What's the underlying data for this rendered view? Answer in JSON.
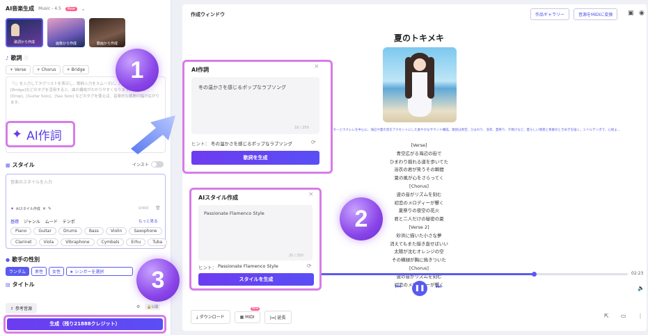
{
  "left": {
    "title": "AI音楽生成",
    "model": "Music - 4.5",
    "model_badge": "New",
    "presets": [
      "歌詞から作成",
      "画像から作成",
      "動画から作成"
    ],
    "lyrics_label": "歌詞",
    "tags": [
      "+ Verse",
      "+ Chorus",
      "+ Bridge"
    ],
    "lyrics_placeholder": "「/」を入力してタグリストを表示し、歌詞入力をスムーズに。[Verse]、[Chorus]、[Bridge]などのタグを活用すると、曲の構成がわかりやすくなります。さらに、[Drop]、[Guitar Solo]、[Sax Solo] などのタグを使えば、音楽的な展開の幅が広がります。",
    "ai_lyrics_big": "AI作詞",
    "style_label": "スタイル",
    "instrumental_label": "インスト",
    "style_placeholder": "音楽のスタイルを入力",
    "ai_style_small": "AIスタイル作成",
    "style_counter": "0/400",
    "style_tabs": [
      "基礎",
      "ジャンル",
      "ムード",
      "テンポ"
    ],
    "more": "もっと見る",
    "instruments_row1": [
      "Piano",
      "Guitar",
      "Drums",
      "Bass",
      "Violin",
      "Saxophone"
    ],
    "instruments_row2": [
      "Clarinet",
      "Viola",
      "Vibraphone",
      "Cymbals",
      "Erhu",
      "Tuba"
    ],
    "gender_label": "歌手の性別",
    "gender_options": [
      "ランダム",
      "男性",
      "女性"
    ],
    "singer_select": "シンガーを選択",
    "title_label": "タイトル",
    "ref_audio": "参考音源",
    "toggle_label": "公開",
    "generate": "生成（残り21888クレジット）"
  },
  "main": {
    "window_title": "作成ウィンドウ",
    "gallery_btn": "作品ギャラリー",
    "midi_convert_btn": "音源をMIDIに変換",
    "song_title": "夏のトキメキ",
    "style_desc": "ギターとウクレレを中心に、海辺や夏の音をアクセントにした爽やかなサウンド構成。歌詞は青空、ひまわり、浴衣、夏祭り、夕焼けなど、夏らしい情景と青春のときめきを描く。ミドルテンポで、心地よ…",
    "lyrics": [
      "[Verse]",
      "青空広がる海辺の街で",
      "ひまわり揺れる道を歩いてた",
      "浴衣の君が笑うその瞬間",
      "夏の風が心をさらってく",
      "[Chorus]",
      "波の音がリズムを刻む",
      "初恋のメロディーが響く",
      "夏祭りの夜空の花火",
      "君と二人だけの秘密の夏",
      "[Verse 2]",
      "砂浜に描いた小さな夢",
      "消えてもまた描き直せばいい",
      "太陽が沈むオレンジの空",
      "その横顔が胸に焼きついた",
      "[Chorus]",
      "波の音がリズムを刻む",
      "初恋のメロディーが響く"
    ],
    "time": "02:23",
    "progress": 0.7,
    "download": "ダウンロード",
    "midi": "MIDI",
    "midi_badge": "New",
    "extend": "延長"
  },
  "popup1": {
    "title": "AI作詞",
    "text": "冬の温かさを感じるポップなラブソング",
    "counter": "18 / 250",
    "hint_label": "ヒント：",
    "hint": "冬の温かさを感じるポップなラブソング",
    "button": "歌詞を生成"
  },
  "popup2": {
    "title": "AIスタイル作成",
    "text": "Passionate Flamenco Style",
    "counter": "25 / 250",
    "hint_label": "ヒント：",
    "hint": "Passionate Flamenco Style",
    "button": "スタイルを生成"
  },
  "badges": [
    "1",
    "2",
    "3"
  ],
  "colors": {
    "accent": "#5a4ef5",
    "highlight": "#d77ce8",
    "badge": "#8a45e8"
  }
}
